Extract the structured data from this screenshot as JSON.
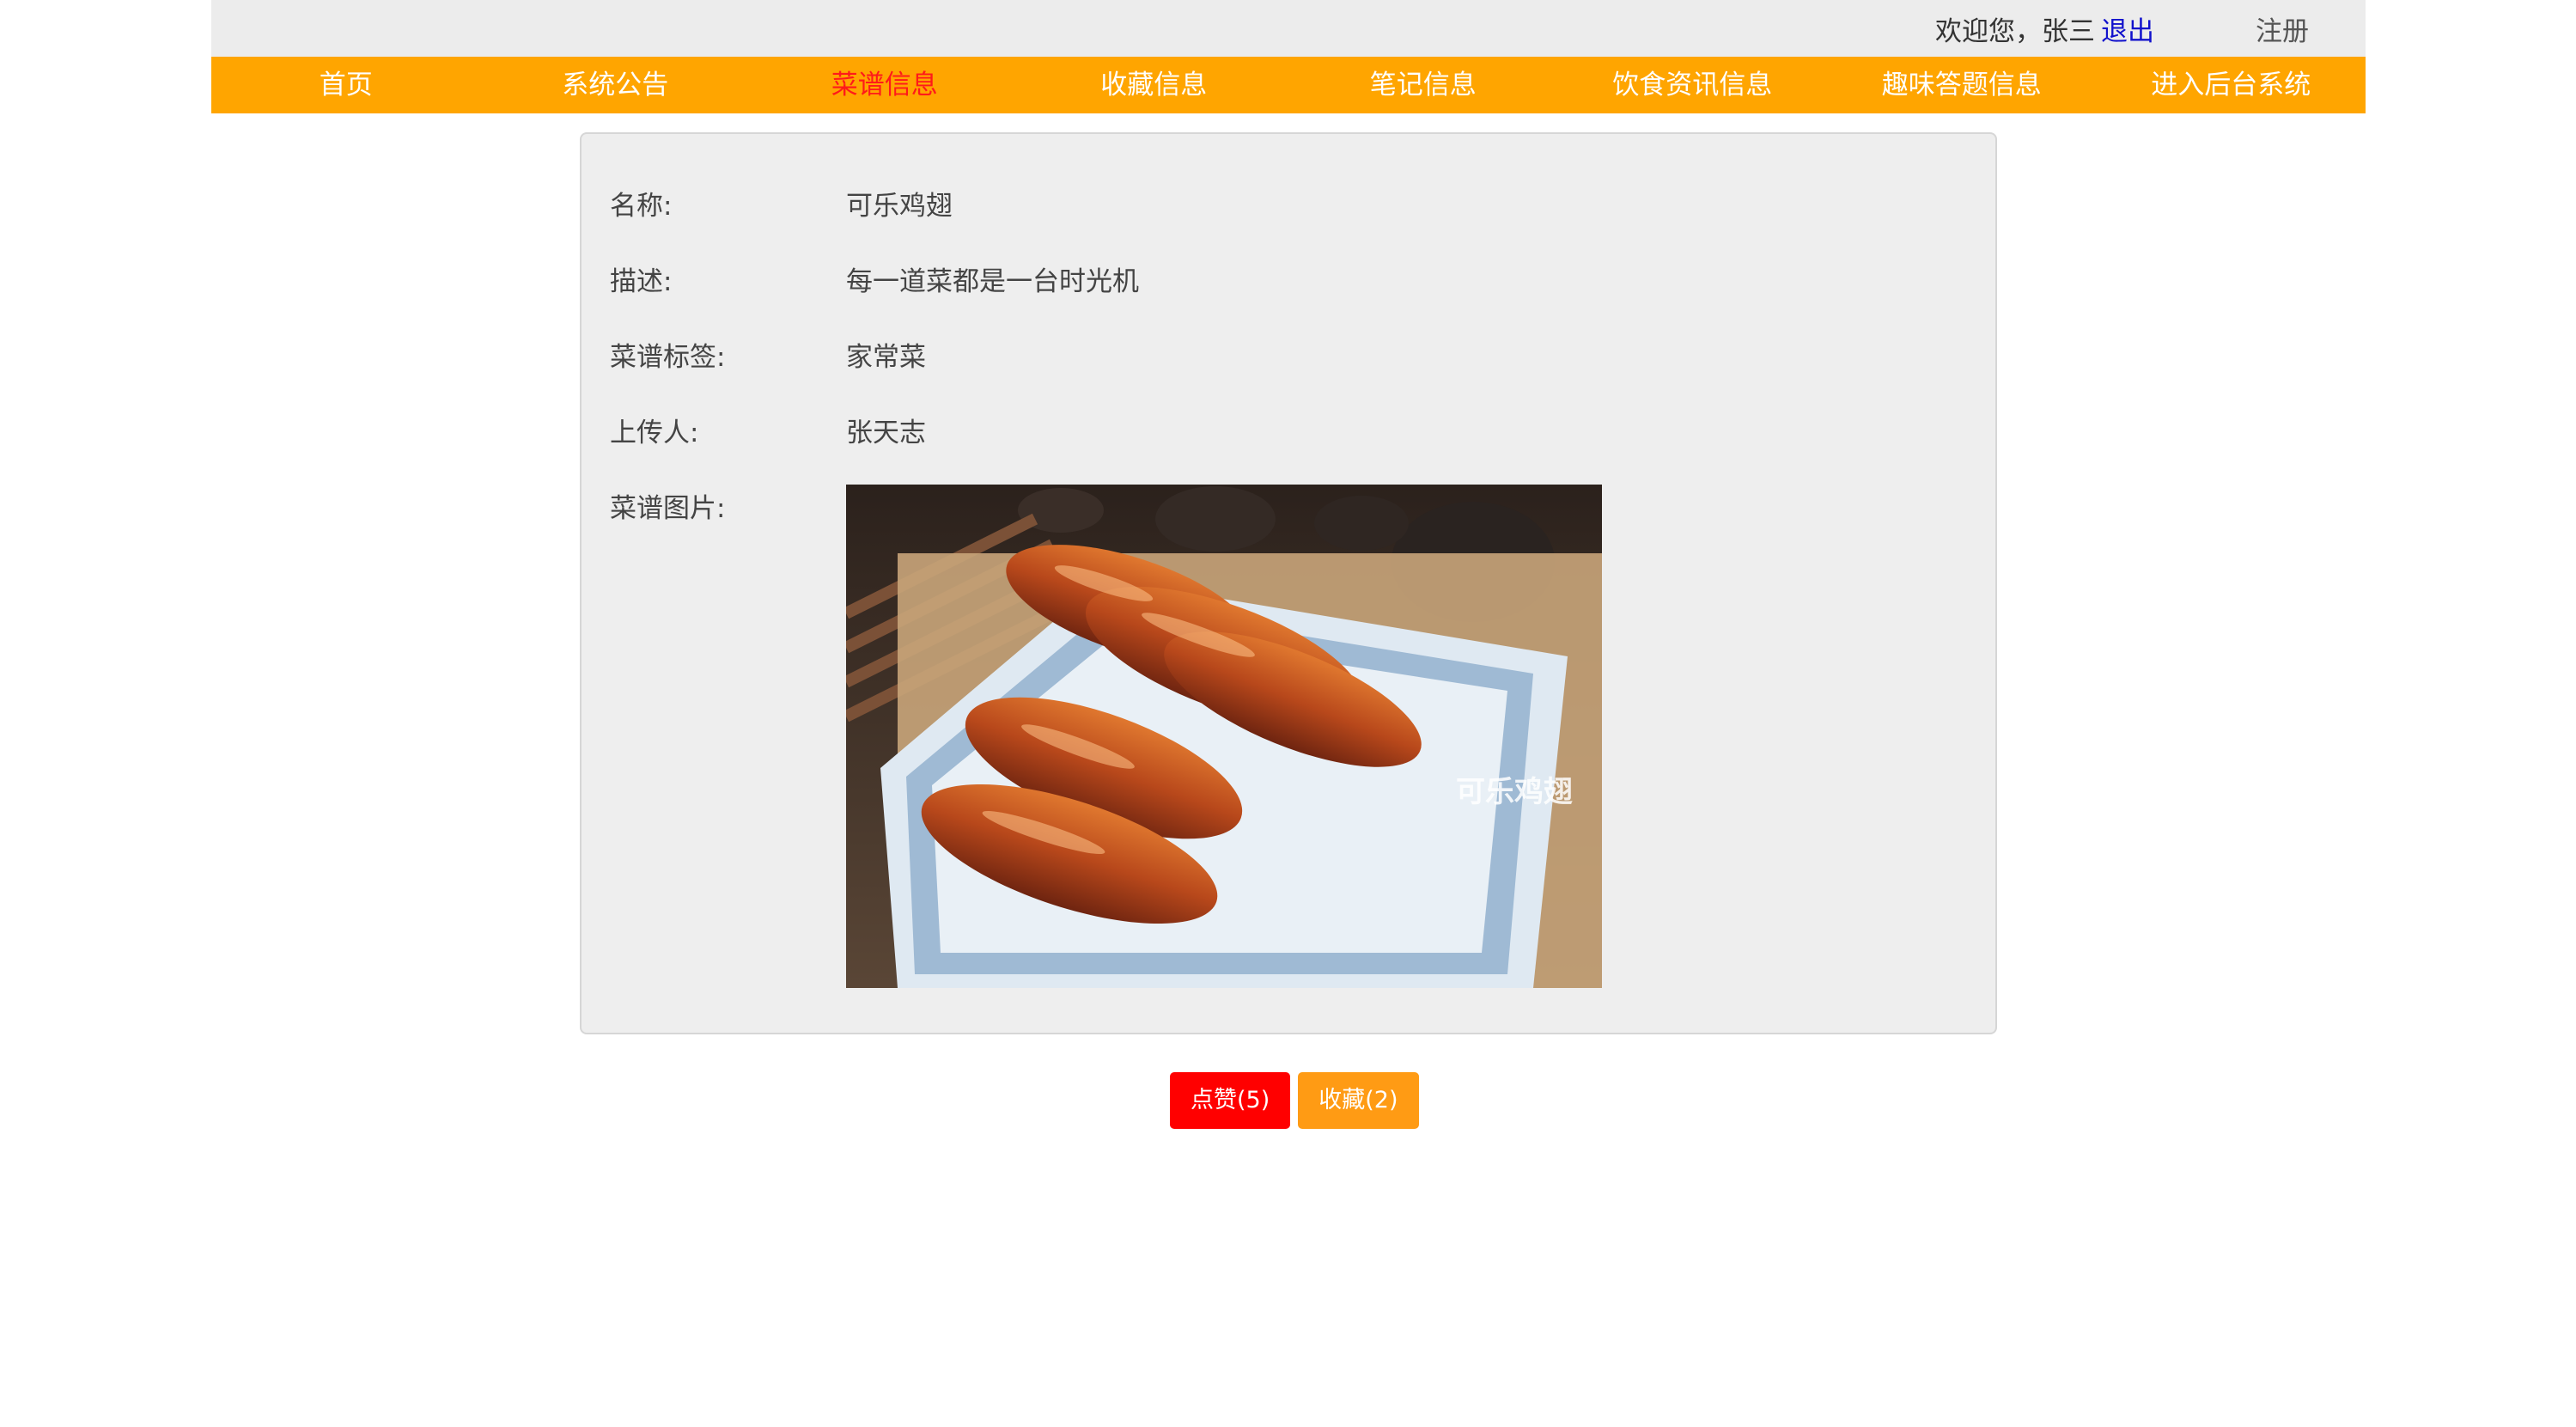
{
  "header": {
    "welcome_text": "欢迎您，张三",
    "logout_label": "退出",
    "register_label": "注册"
  },
  "nav": {
    "items": [
      {
        "label": "首页"
      },
      {
        "label": "系统公告"
      },
      {
        "label": "菜谱信息"
      },
      {
        "label": "收藏信息"
      },
      {
        "label": "笔记信息"
      },
      {
        "label": "饮食资讯信息"
      },
      {
        "label": "趣味答题信息"
      },
      {
        "label": "进入后台系统"
      }
    ],
    "active_index": 2
  },
  "recipe": {
    "name_label": "名称:",
    "name_value": "可乐鸡翅",
    "desc_label": "描述:",
    "desc_value": "每一道菜都是一台时光机",
    "tag_label": "菜谱标签:",
    "tag_value": "家常菜",
    "uploader_label": "上传人:",
    "uploader_value": "张天志",
    "image_label": "菜谱图片:",
    "image_caption": "可乐鸡翅"
  },
  "actions": {
    "like_label": "点赞(5)",
    "favorite_label": "收藏(2)"
  },
  "colors": {
    "nav_bg": "#ffa500",
    "nav_active": "#ff1a1a",
    "like_button": "#ff0000",
    "favorite_button": "#ff9b14",
    "logout_link": "#1111cc"
  }
}
